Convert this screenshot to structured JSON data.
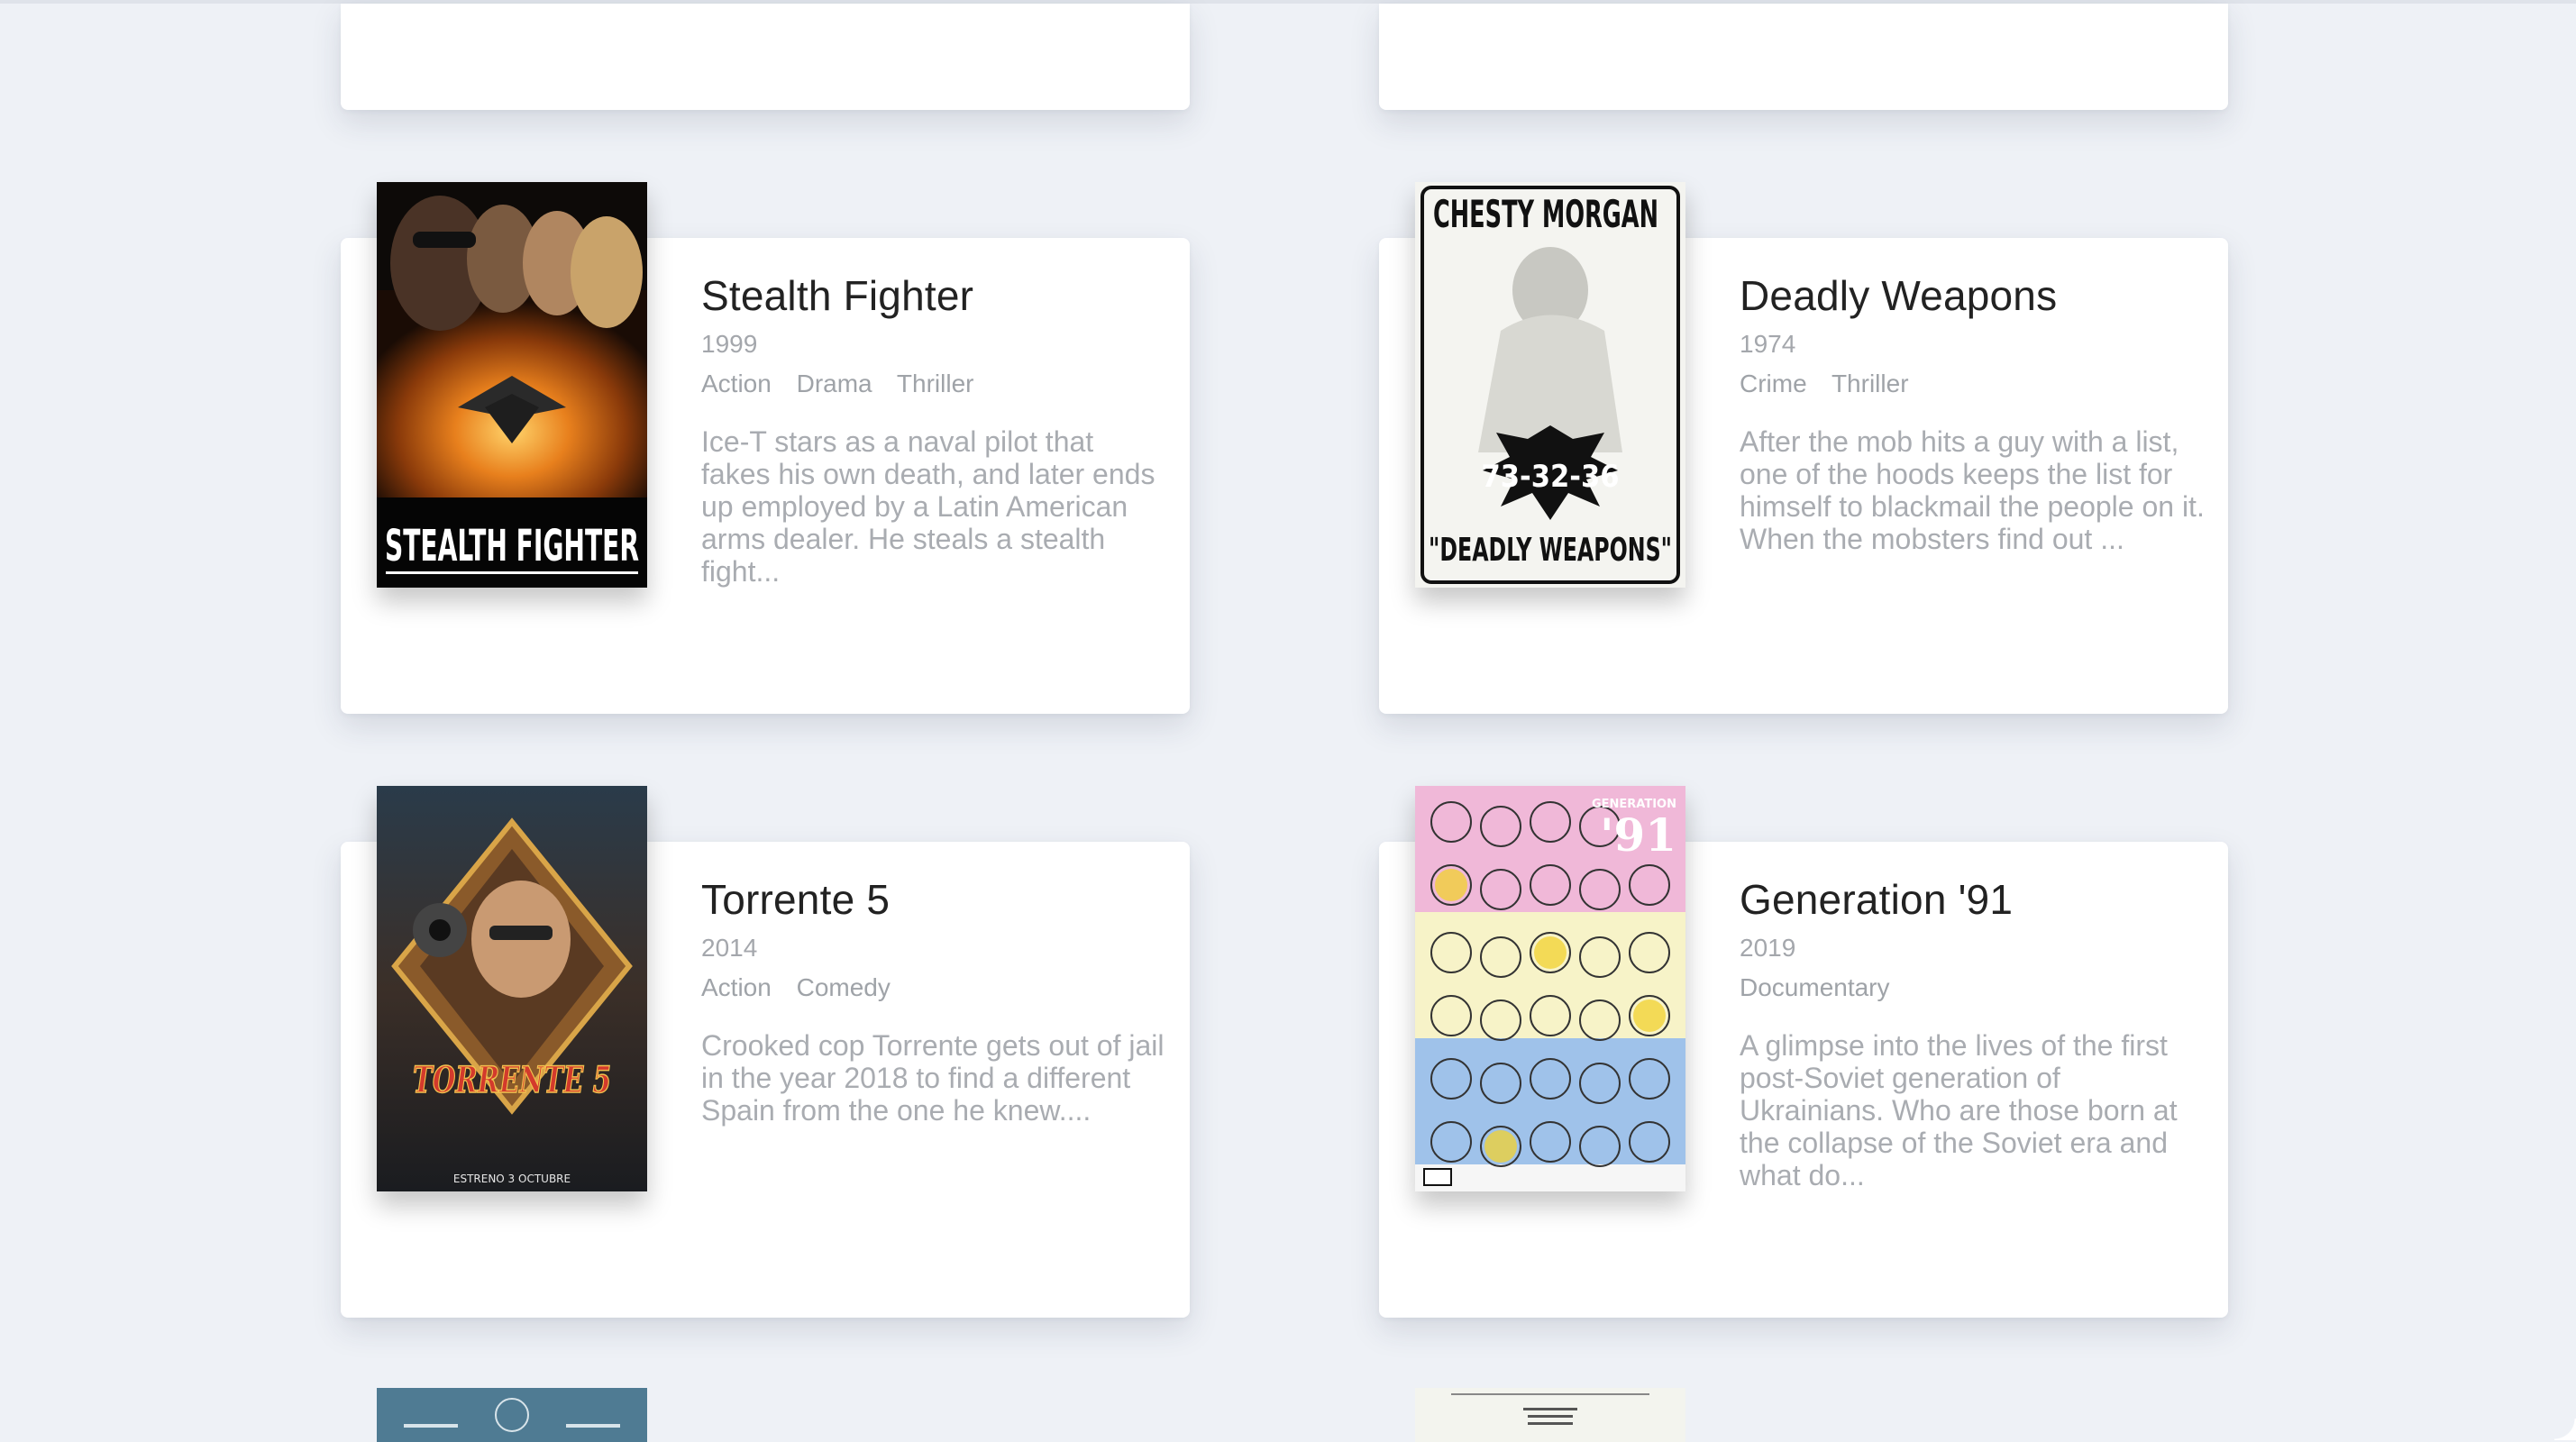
{
  "movies": [
    {
      "title": "Stealth Fighter",
      "year": "1999",
      "genres": [
        "Action",
        "Drama",
        "Thriller"
      ],
      "description": "Ice-T stars as a naval pilot that fakes his own death, and later ends up employed by a Latin American arms dealer. He steals a stealth fight...",
      "poster_text": "STEALTH FIGHTER"
    },
    {
      "title": "Deadly Weapons",
      "year": "1974",
      "genres": [
        "Crime",
        "Thriller"
      ],
      "description": "After the mob hits a guy with a list, one of the hoods keeps the list for himself to blackmail the people on it. When the mobsters find out ...",
      "poster_text": {
        "headline": "CHESTY MORGAN",
        "numbers": "73-32-36",
        "tagline": "\"DEADLY WEAPONS\""
      }
    },
    {
      "title": "Torrente 5",
      "year": "2014",
      "genres": [
        "Action",
        "Comedy"
      ],
      "description": "Crooked cop Torrente gets out of jail in the year 2018 to find a different Spain from the one he knew....",
      "poster_text": {
        "logo": "TORRENTE 5",
        "release": "ESTRENO 3 OCTUBRE"
      }
    },
    {
      "title": "Generation '91",
      "year": "2019",
      "genres": [
        "Documentary"
      ],
      "description": "A glimpse into the lives of the first post-Soviet generation of Ukrainians. Who are those born at the collapse of the Soviet era and what do...",
      "poster_text": {
        "label": "GENERATION",
        "big": "'91"
      }
    }
  ],
  "colors": {
    "background": "#eef1f6",
    "card": "#ffffff",
    "title": "#222222",
    "muted": "#a4a7ac"
  }
}
